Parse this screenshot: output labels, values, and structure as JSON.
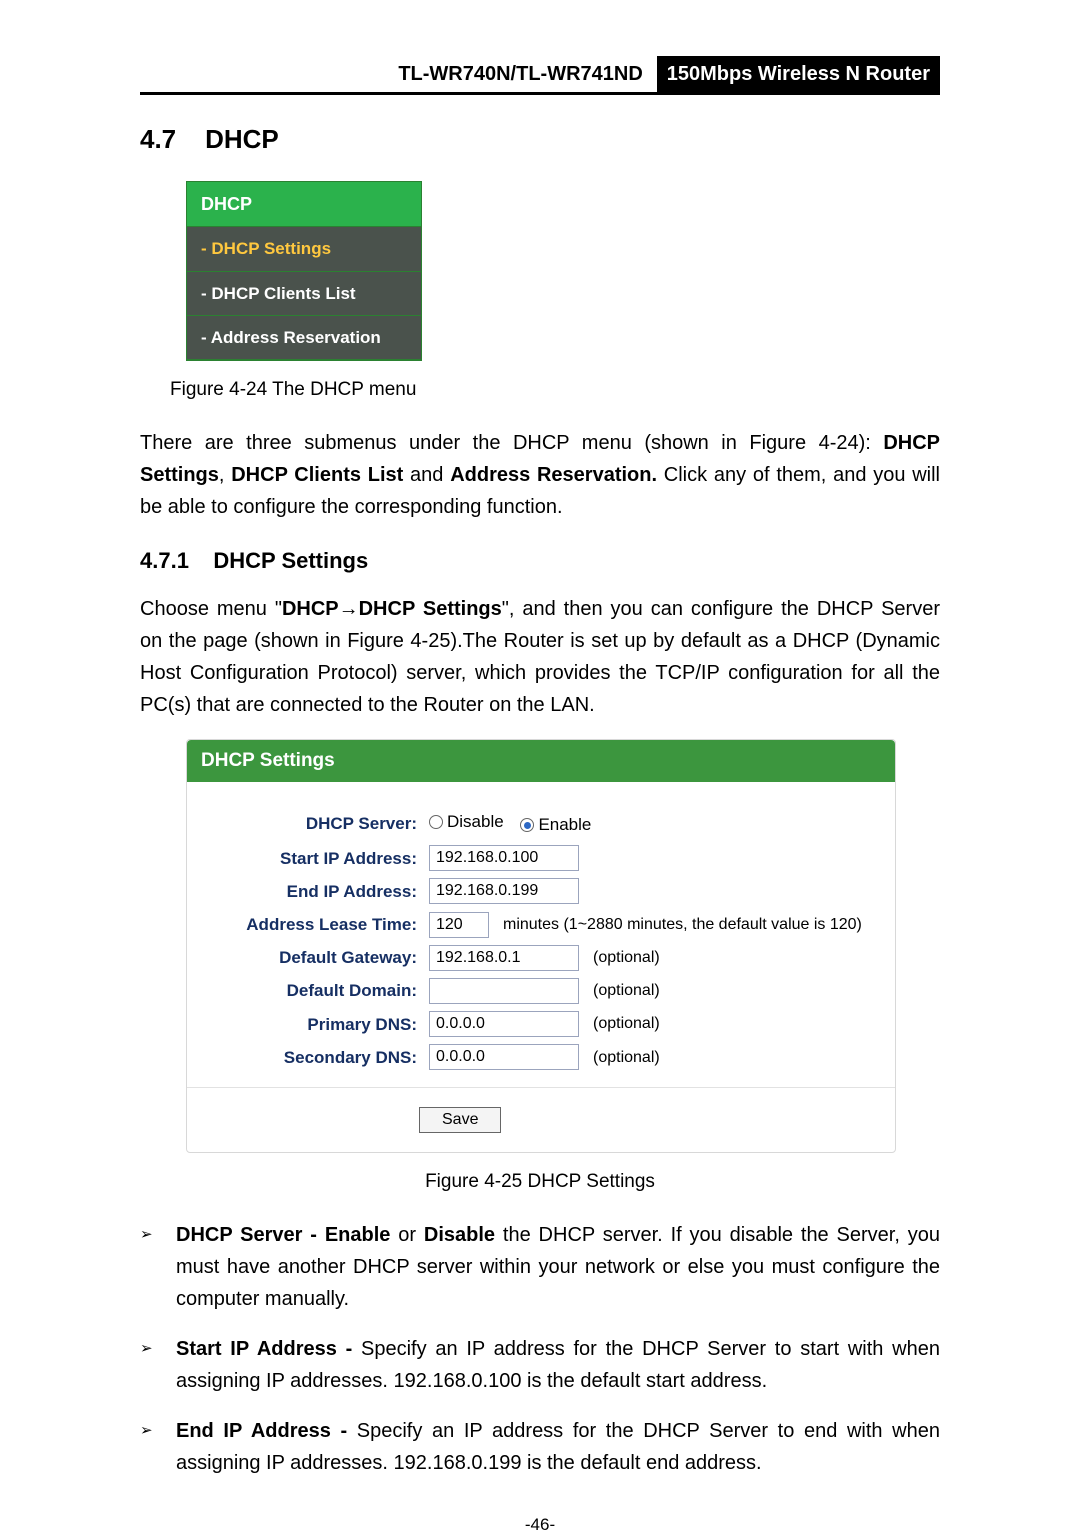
{
  "header": {
    "model": "TL-WR740N/TL-WR741ND",
    "badge": "150Mbps Wireless N Router"
  },
  "section": {
    "num": "4.7",
    "title": "DHCP"
  },
  "menu": {
    "title": "DHCP",
    "items": [
      {
        "label": "- DHCP Settings",
        "active": true
      },
      {
        "label": "- DHCP Clients List",
        "active": false
      },
      {
        "label": "- Address Reservation",
        "active": false
      }
    ]
  },
  "caption1": "Figure 4-24    The DHCP menu",
  "para1_a": "There are three submenus under the DHCP menu (shown in ",
  "para1_b": "Figure 4-24",
  "para1_c": "): ",
  "para1_d": "DHCP Settings",
  "para1_e": ", ",
  "para1_f": "DHCP Clients List",
  "para1_g": " and ",
  "para1_h": "Address Reservation.",
  "para1_i": " Click any of them, and you will be able to configure the corresponding function.",
  "subsection": {
    "num": "4.7.1",
    "title": "DHCP Settings"
  },
  "para2_a": "Choose menu \"",
  "para2_b": "DHCP→DHCP Settings",
  "para2_c": "\", and then you can configure the DHCP Server on the page (shown in ",
  "para2_d": "Figure 4-25",
  "para2_e": ").The Router is set up by default as a DHCP (Dynamic Host Configuration Protocol) server, which provides the TCP/IP configuration for all the PC(s) that are connected to the Router on the LAN.",
  "panel": {
    "title": "DHCP Settings",
    "rows": {
      "dhcp_server": "DHCP Server:",
      "disable": "Disable",
      "enable": "Enable",
      "start_ip_label": "Start IP Address:",
      "start_ip": "192.168.0.100",
      "end_ip_label": "End IP Address:",
      "end_ip": "192.168.0.199",
      "lease_label": "Address Lease Time:",
      "lease": "120",
      "lease_note": "minutes (1~2880 minutes, the default value is 120)",
      "gateway_label": "Default Gateway:",
      "gateway": "192.168.0.1",
      "domain_label": "Default Domain:",
      "domain": "",
      "pdns_label": "Primary DNS:",
      "pdns": "0.0.0.0",
      "sdns_label": "Secondary DNS:",
      "sdns": "0.0.0.0",
      "optional": "(optional)",
      "save": "Save"
    }
  },
  "caption2": "Figure 4-25    DHCP Settings",
  "bullets": [
    {
      "t1": "DHCP Server - ",
      "t2": "Enable",
      "t3": " or ",
      "t4": "Disable",
      "t5": " the DHCP server. If you disable the Server, you must have another DHCP server within your network or else you must configure the computer manually."
    },
    {
      "t1": "Start IP Address - ",
      "t2": "",
      "t3": "",
      "t4": "",
      "t5": "Specify an IP address for the DHCP Server to start with when assigning IP addresses. 192.168.0.100 is the default start address."
    },
    {
      "t1": "End IP Address - ",
      "t2": "",
      "t3": "",
      "t4": "",
      "t5": "Specify an IP address for the DHCP Server to end with when assigning IP addresses. 192.168.0.199 is the default end address."
    }
  ],
  "page_num": "-46-"
}
